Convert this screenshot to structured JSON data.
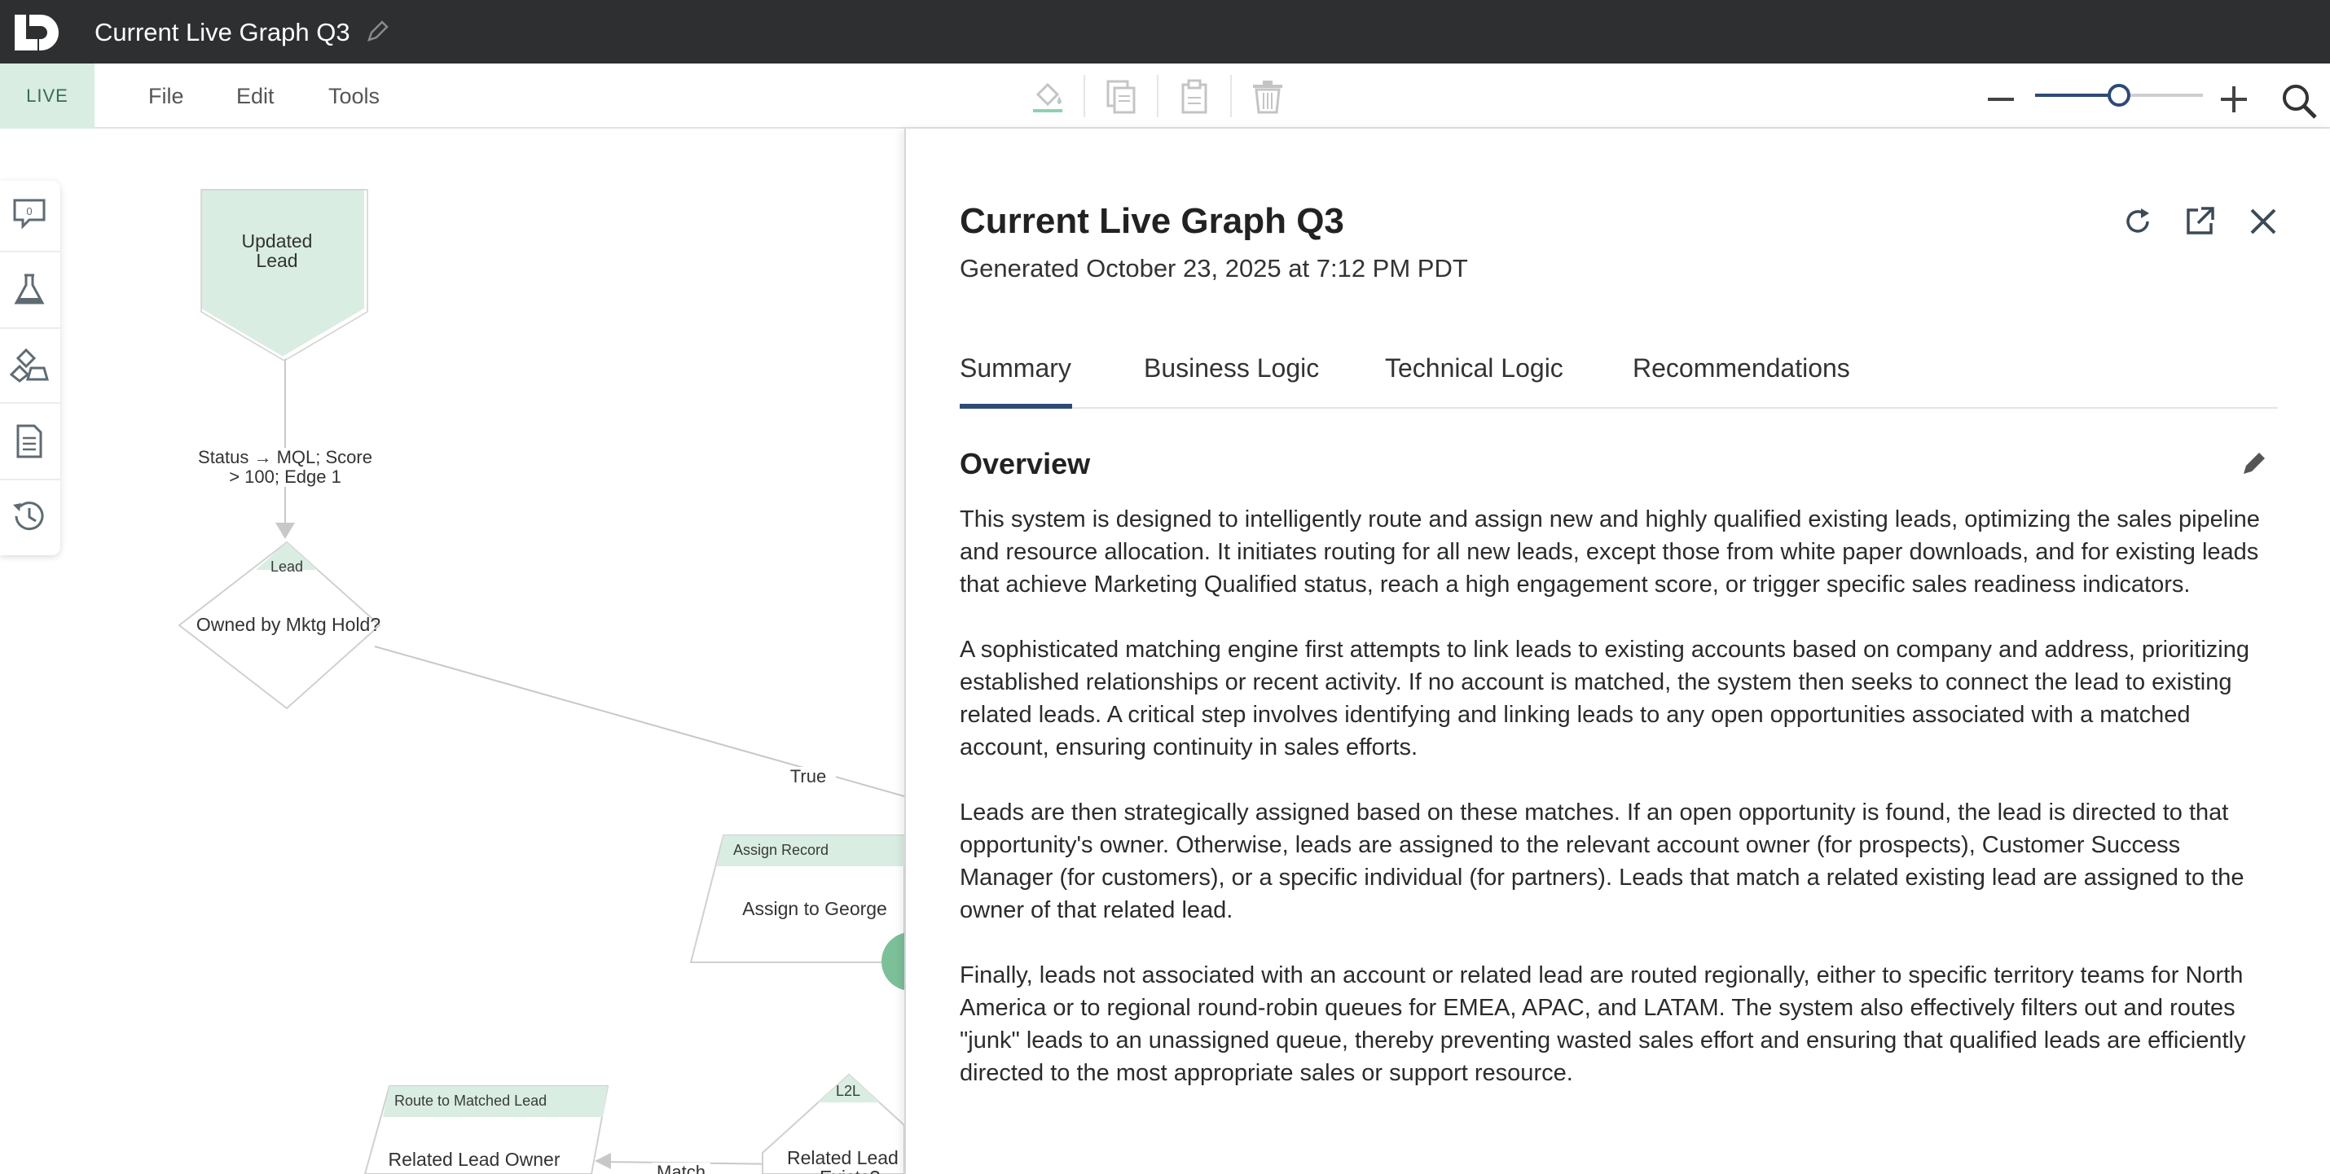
{
  "app": {
    "title": "Current Live Graph Q3",
    "logo": "LD-logo",
    "title_edit_icon": "pencil-icon"
  },
  "menubar": {
    "live_label": "LIVE",
    "menus": [
      "File",
      "Edit",
      "Tools"
    ],
    "tools": [
      "paint-bucket-icon",
      "copy-icon",
      "clipboard-icon",
      "trash-icon"
    ],
    "zoom_minus_icon": "minus-icon",
    "zoom_plus_icon": "plus-icon",
    "zoom_level": 0.5,
    "search_icon": "search-icon"
  },
  "rail": {
    "comment_count": "0",
    "icons": [
      "comment-icon",
      "flask-icon",
      "shapes-icon",
      "document-icon",
      "history-icon"
    ]
  },
  "graph": {
    "trigger": {
      "label_1": "Updated",
      "label_2": "Lead"
    },
    "edge1": {
      "line1": "Status → MQL; Score",
      "line2": "> 100; Edge 1"
    },
    "decision1": {
      "tag": "Lead",
      "label": "Owned by Mktg Hold?"
    },
    "edge_true": "True",
    "assign": {
      "tag": "Assign Record",
      "label": "Assign to George"
    },
    "route": {
      "tag": "Route to Matched Lead",
      "label": "Related Lead Owner"
    },
    "edge_match": "Match",
    "decision2": {
      "tag": "L2L",
      "label_1": "Related Lead",
      "label_2": "Exists?"
    }
  },
  "panel": {
    "title": "Current Live Graph Q3",
    "subtitle": "Generated October 23, 2025 at 7:12 PM PDT",
    "actions": [
      "refresh-icon",
      "external-link-icon",
      "close-icon"
    ],
    "tabs": [
      "Summary",
      "Business Logic",
      "Technical Logic",
      "Recommendations"
    ],
    "active_tab": "Summary",
    "overview_title": "Overview",
    "paragraphs": [
      "This system is designed to intelligently route and assign new and highly qualified existing leads, optimizing the sales pipeline and resource allocation. It initiates routing for all new leads, except those from white paper downloads, and for existing leads that achieve Marketing Qualified status, reach a high engagement score, or trigger specific sales readiness indicators.",
      "A sophisticated matching engine first attempts to link leads to existing accounts based on company and address, prioritizing established relationships or recent activity. If no account is matched, the system then seeks to connect the lead to existing related leads. A critical step involves identifying and linking leads to any open opportunities associated with a matched account, ensuring continuity in sales efforts.",
      "Leads are then strategically assigned based on these matches. If an open opportunity is found, the lead is directed to that opportunity's owner. Otherwise, leads are assigned to the relevant account owner (for prospects), Customer Success Manager (for customers), or a specific individual (for partners). Leads that match a related existing lead are assigned to the owner of that related lead.",
      "Finally, leads not associated with an account or related lead are routed regionally, either to specific territory teams for North America or to regional round-robin queues for EMEA, APAC, and LATAM. The system also effectively filters out and routes \"junk\" leads to an unassigned queue, thereby preventing wasted sales effort and ensuring that qualified leads are efficiently directed to the most appropriate sales or support resource."
    ]
  }
}
